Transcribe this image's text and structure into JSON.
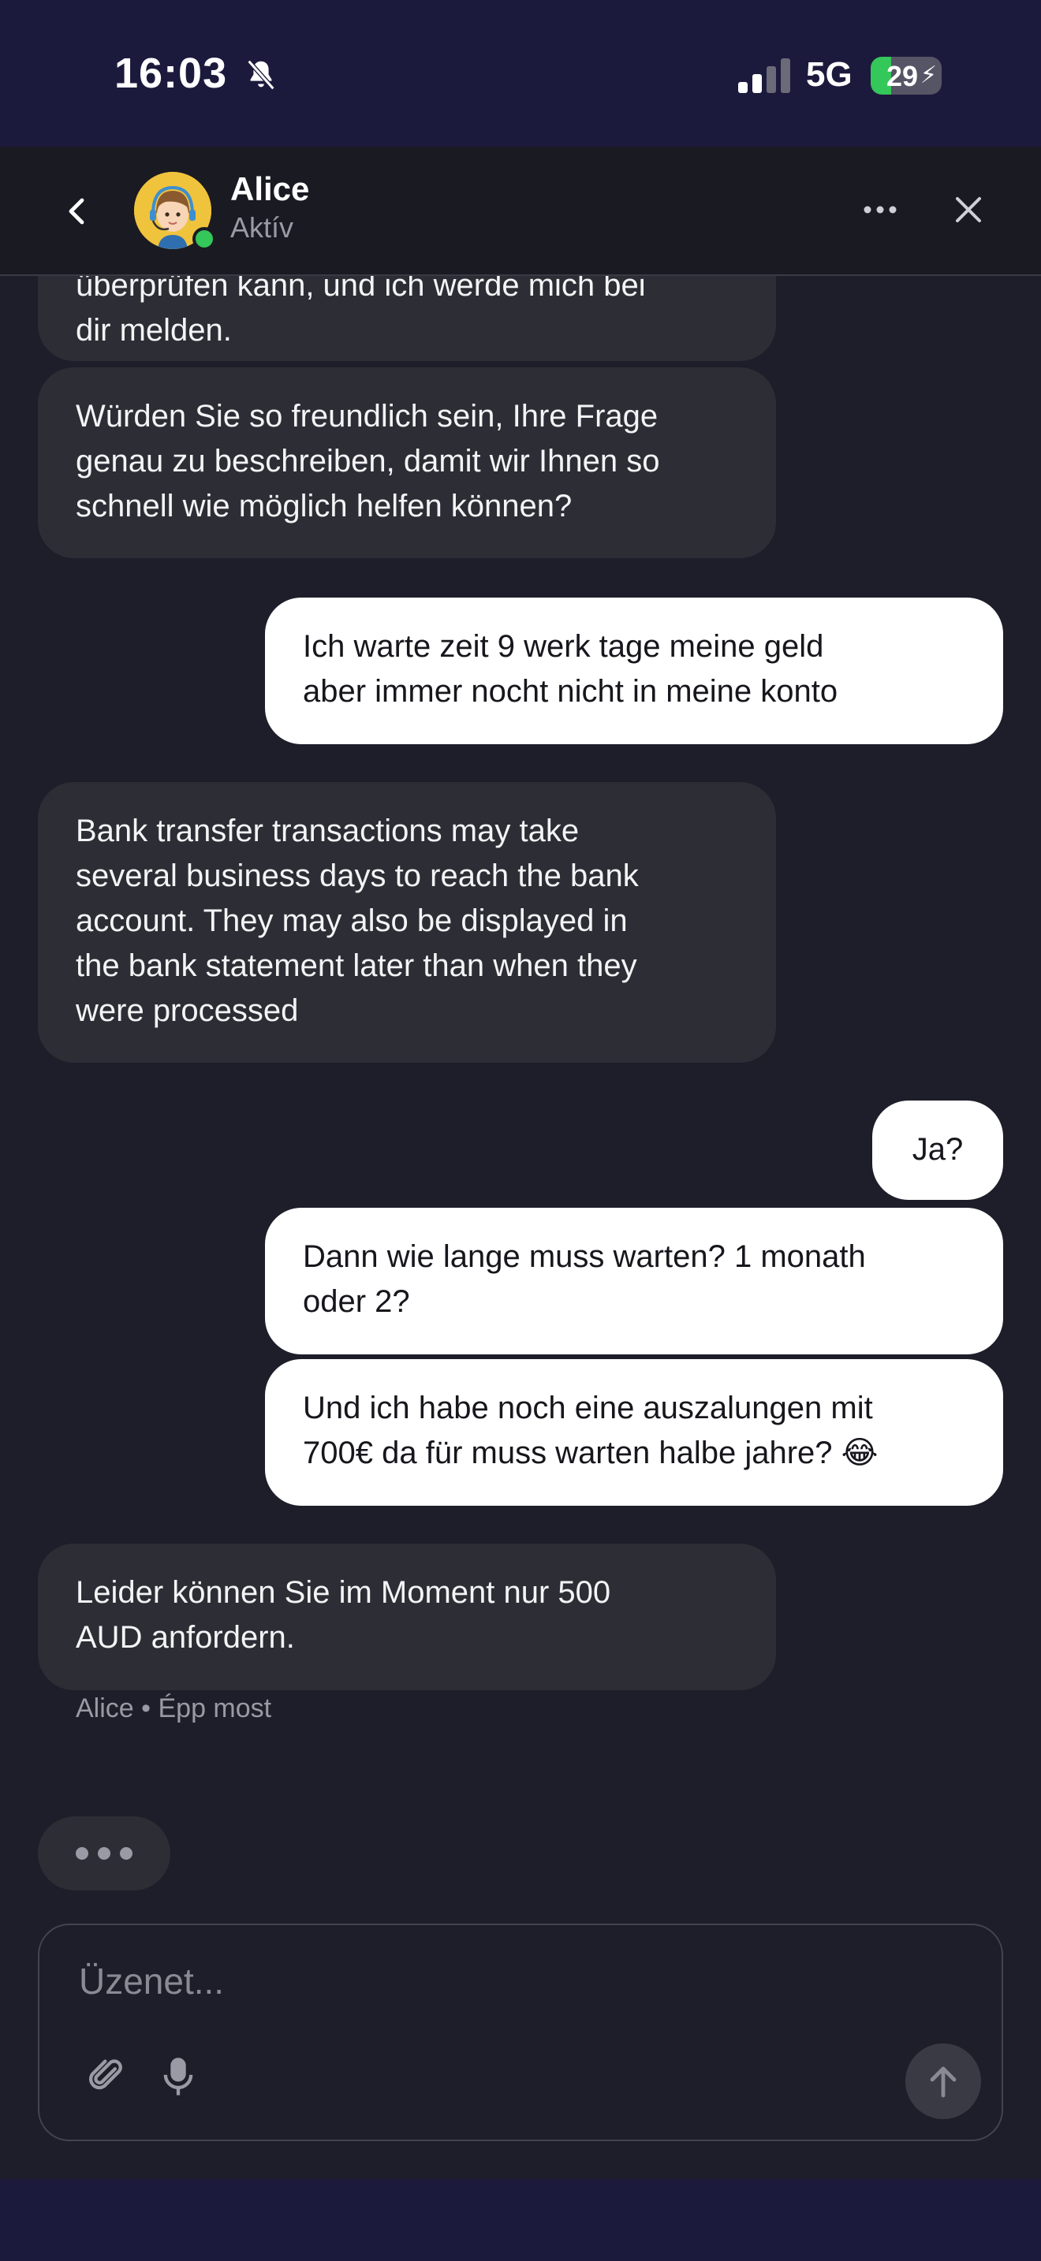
{
  "status_bar": {
    "time": "16:03",
    "network": "5G",
    "battery": "29",
    "battery_level_percent": 29,
    "icons": [
      "bell-slash-icon",
      "signal-icon",
      "battery-charging-icon"
    ]
  },
  "header": {
    "agent_name": "Alice",
    "agent_status": "Aktív",
    "icons": [
      "chevron-left-icon",
      "avatar",
      "more-icon",
      "close-icon"
    ]
  },
  "messages": [
    {
      "from": "agent",
      "text": "überprüfen kann, und ich werde mich bei\ndir melden."
    },
    {
      "from": "agent",
      "text": "Würden Sie so freundlich sein, Ihre Frage\ngenau zu beschreiben, damit wir Ihnen so\nschnell wie möglich helfen können?"
    },
    {
      "from": "user",
      "text": "Ich warte zeit 9 werk tage meine geld\naber immer nocht nicht in meine konto"
    },
    {
      "from": "agent",
      "text": "Bank transfer transactions may take\nseveral business days to reach the bank\naccount. They may also be displayed in\nthe bank statement later than when they\nwere processed"
    },
    {
      "from": "user",
      "text": "Ja?"
    },
    {
      "from": "user",
      "text": "Dann wie lange muss warten? 1 monath\noder 2?"
    },
    {
      "from": "user",
      "text": "Und ich habe noch eine auszalungen mit\n700€ da für muss warten halbe jahre? 😂"
    },
    {
      "from": "agent",
      "text": "Leider können Sie im Moment nur 500\nAUD anfordern."
    }
  ],
  "last_message_meta": "Alice • Épp most",
  "composer": {
    "placeholder": "Üzenet...",
    "icons": [
      "paperclip-icon",
      "microphone-icon",
      "arrow-up-icon"
    ]
  },
  "colors": {
    "background": "#1e1e2a",
    "status_bar": "#1c1a3c",
    "agent_bubble": "#2d2d35",
    "user_bubble": "#ffffff",
    "online": "#34c759",
    "avatar": "#f0c33c"
  }
}
